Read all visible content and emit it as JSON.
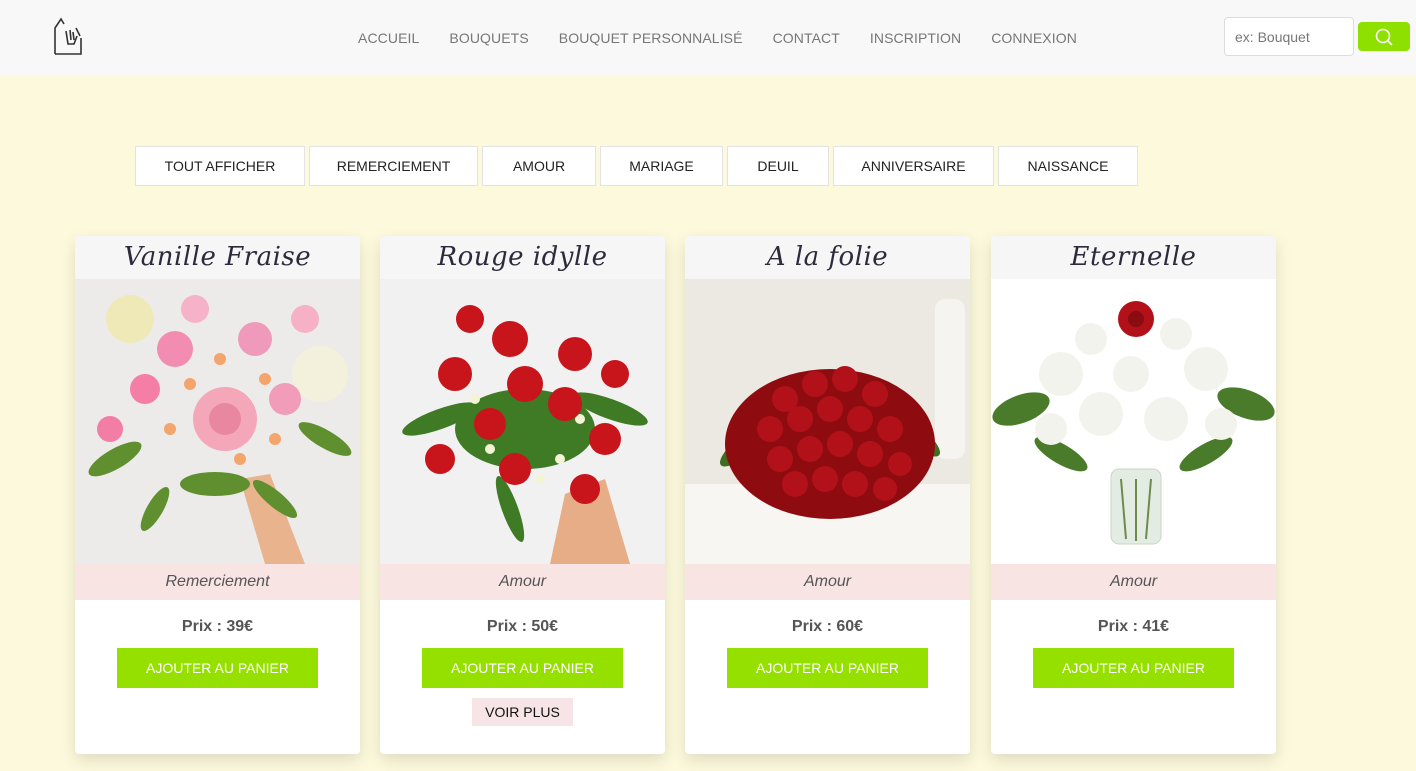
{
  "header": {
    "nav": [
      "ACCUEIL",
      "BOUQUETS",
      "BOUQUET PERSONNALISÉ",
      "CONTACT",
      "INSCRIPTION",
      "CONNEXION"
    ],
    "search_placeholder": "ex: Bouquet"
  },
  "filters": [
    "TOUT AFFICHER",
    "REMERCIEMENT",
    "AMOUR",
    "MARIAGE",
    "DEUIL",
    "ANNIVERSAIRE",
    "NAISSANCE"
  ],
  "cards": [
    {
      "title": "Vanille Fraise",
      "category": "Remerciement",
      "price": "Prix : 39€",
      "add_label": "AJOUTER AU PANIER"
    },
    {
      "title": "Rouge idylle",
      "category": "Amour",
      "price": "Prix : 50€",
      "add_label": "AJOUTER AU PANIER",
      "more_label": "VOIR PLUS"
    },
    {
      "title": "A la folie",
      "category": "Amour",
      "price": "Prix : 60€",
      "add_label": "AJOUTER AU PANIER"
    },
    {
      "title": "Eternelle",
      "category": "Amour",
      "price": "Prix : 41€",
      "add_label": "AJOUTER AU PANIER"
    }
  ],
  "colors": {
    "accent": "#96e000",
    "background": "#fdf9dc",
    "category_bg": "#f9e4e4"
  }
}
